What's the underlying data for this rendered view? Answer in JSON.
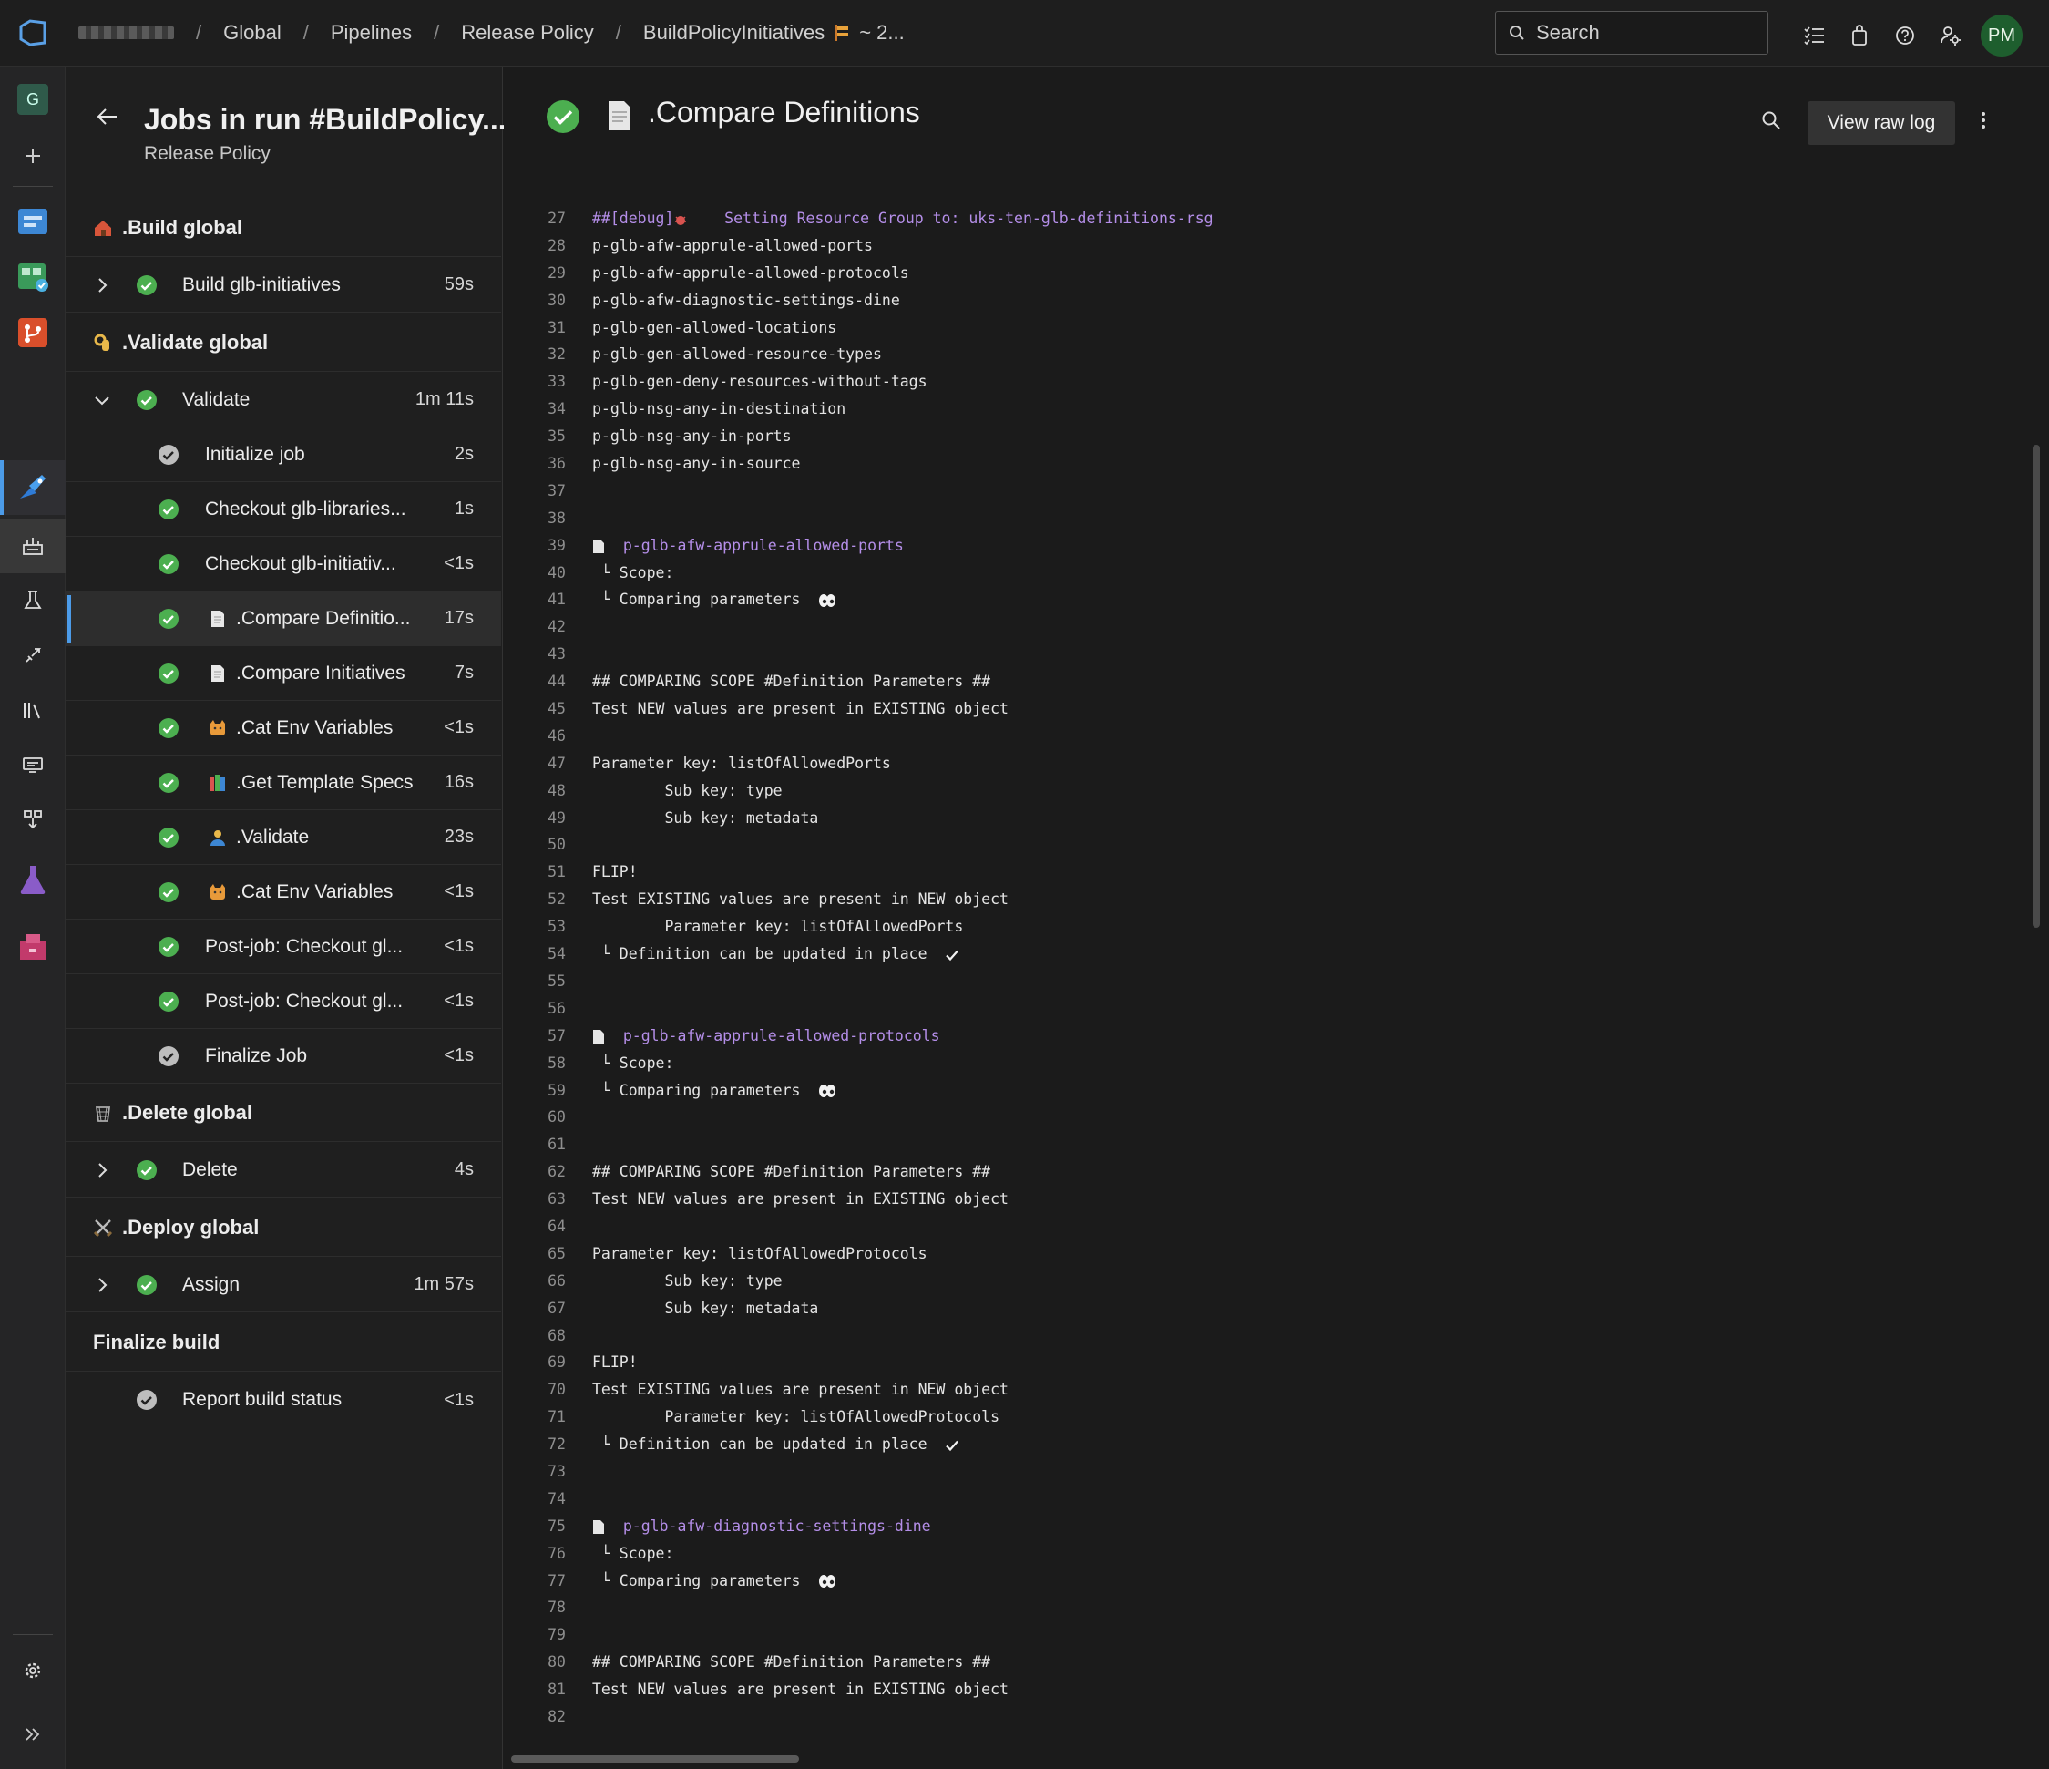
{
  "breadcrumb": {
    "items": [
      "Global",
      "Pipelines",
      "Release Policy",
      "BuildPolicyInitiatives"
    ],
    "run_suffix": "~ 2..."
  },
  "search": {
    "placeholder": "Search"
  },
  "user": {
    "initials": "PM"
  },
  "rail": {
    "org_initial": "G"
  },
  "jobs_panel": {
    "title": "Jobs in run #BuildPolicy...",
    "subtitle": "Release Policy",
    "stages": [
      {
        "name": ".Build global",
        "icon": "house-emoji-icon"
      },
      {
        "name": ".Validate global",
        "icon": "ok-hand-emoji-icon"
      },
      {
        "name": ".Delete global",
        "icon": "wastebasket-emoji-icon"
      },
      {
        "name": ".Deploy global",
        "icon": "crossed-swords-emoji-icon"
      },
      {
        "name": "Finalize build",
        "icon": ""
      }
    ],
    "jobs": [
      {
        "label": "Build glb-initiatives",
        "duration": "59s",
        "status": "succeeded",
        "expanded": false
      },
      {
        "label": "Validate",
        "duration": "1m 11s",
        "status": "succeeded",
        "expanded": true
      },
      {
        "label": "Delete",
        "duration": "4s",
        "status": "succeeded",
        "expanded": false
      },
      {
        "label": "Assign",
        "duration": "1m 57s",
        "status": "succeeded",
        "expanded": false
      },
      {
        "label": "Report build status",
        "duration": "<1s",
        "status": "completed",
        "expanded": false
      }
    ],
    "steps": [
      {
        "label": "Initialize job",
        "duration": "2s",
        "status": "completed",
        "icon": ""
      },
      {
        "label": "Checkout glb-libraries...",
        "duration": "1s",
        "status": "succeeded",
        "icon": ""
      },
      {
        "label": "Checkout glb-initiativ...",
        "duration": "<1s",
        "status": "succeeded",
        "icon": ""
      },
      {
        "label": ".Compare Definitio...",
        "duration": "17s",
        "status": "succeeded",
        "icon": "page-emoji-icon",
        "selected": true
      },
      {
        "label": ".Compare Initiatives",
        "duration": "7s",
        "status": "succeeded",
        "icon": "page-emoji-icon"
      },
      {
        "label": ".Cat Env Variables",
        "duration": "<1s",
        "status": "succeeded",
        "icon": "cat-emoji-icon"
      },
      {
        "label": ".Get Template Specs",
        "duration": "16s",
        "status": "succeeded",
        "icon": "books-emoji-icon"
      },
      {
        "label": ".Validate",
        "duration": "23s",
        "status": "succeeded",
        "icon": "person-emoji-icon"
      },
      {
        "label": ".Cat Env Variables",
        "duration": "<1s",
        "status": "succeeded",
        "icon": "cat-emoji-icon"
      },
      {
        "label": "Post-job: Checkout gl...",
        "duration": "<1s",
        "status": "succeeded",
        "icon": ""
      },
      {
        "label": "Post-job: Checkout gl...",
        "duration": "<1s",
        "status": "succeeded",
        "icon": ""
      },
      {
        "label": "Finalize Job",
        "duration": "<1s",
        "status": "completed",
        "icon": ""
      }
    ]
  },
  "log": {
    "title": ".Compare Definitions",
    "view_raw_label": "View raw log",
    "lines": [
      {
        "n": "27",
        "t": "##[debug]",
        "extra": "    Setting Resource Group to: uks-ten-glb-definitions-rsg",
        "kind": "debug"
      },
      {
        "n": "28",
        "t": "p-glb-afw-apprule-allowed-ports"
      },
      {
        "n": "29",
        "t": "p-glb-afw-apprule-allowed-protocols"
      },
      {
        "n": "30",
        "t": "p-glb-afw-diagnostic-settings-dine"
      },
      {
        "n": "31",
        "t": "p-glb-gen-allowed-locations"
      },
      {
        "n": "32",
        "t": "p-glb-gen-allowed-resource-types"
      },
      {
        "n": "33",
        "t": "p-glb-gen-deny-resources-without-tags"
      },
      {
        "n": "34",
        "t": "p-glb-nsg-any-in-destination"
      },
      {
        "n": "35",
        "t": "p-glb-nsg-any-in-ports"
      },
      {
        "n": "36",
        "t": "p-glb-nsg-any-in-source"
      },
      {
        "n": "37",
        "t": ""
      },
      {
        "n": "38",
        "t": ""
      },
      {
        "n": "39",
        "t": "  p-glb-afw-apprule-allowed-ports",
        "kind": "doc"
      },
      {
        "n": "40",
        "t": " └ Scope:"
      },
      {
        "n": "41",
        "t": " └ Comparing parameters  ",
        "kind": "eyes"
      },
      {
        "n": "42",
        "t": ""
      },
      {
        "n": "43",
        "t": ""
      },
      {
        "n": "44",
        "t": "## COMPARING SCOPE #Definition Parameters ##"
      },
      {
        "n": "45",
        "t": "Test NEW values are present in EXISTING object"
      },
      {
        "n": "46",
        "t": ""
      },
      {
        "n": "47",
        "t": "Parameter key: listOfAllowedPorts"
      },
      {
        "n": "48",
        "t": "        Sub key: type"
      },
      {
        "n": "49",
        "t": "        Sub key: metadata"
      },
      {
        "n": "50",
        "t": ""
      },
      {
        "n": "51",
        "t": "FLIP!"
      },
      {
        "n": "52",
        "t": "Test EXISTING values are present in NEW object"
      },
      {
        "n": "53",
        "t": "        Parameter key: listOfAllowedPorts"
      },
      {
        "n": "54",
        "t": " └ Definition can be updated in place  ",
        "kind": "check"
      },
      {
        "n": "55",
        "t": ""
      },
      {
        "n": "56",
        "t": ""
      },
      {
        "n": "57",
        "t": "  p-glb-afw-apprule-allowed-protocols",
        "kind": "doc"
      },
      {
        "n": "58",
        "t": " └ Scope:"
      },
      {
        "n": "59",
        "t": " └ Comparing parameters  ",
        "kind": "eyes"
      },
      {
        "n": "60",
        "t": ""
      },
      {
        "n": "61",
        "t": ""
      },
      {
        "n": "62",
        "t": "## COMPARING SCOPE #Definition Parameters ##"
      },
      {
        "n": "63",
        "t": "Test NEW values are present in EXISTING object"
      },
      {
        "n": "64",
        "t": ""
      },
      {
        "n": "65",
        "t": "Parameter key: listOfAllowedProtocols"
      },
      {
        "n": "66",
        "t": "        Sub key: type"
      },
      {
        "n": "67",
        "t": "        Sub key: metadata"
      },
      {
        "n": "68",
        "t": ""
      },
      {
        "n": "69",
        "t": "FLIP!"
      },
      {
        "n": "70",
        "t": "Test EXISTING values are present in NEW object"
      },
      {
        "n": "71",
        "t": "        Parameter key: listOfAllowedProtocols"
      },
      {
        "n": "72",
        "t": " └ Definition can be updated in place  ",
        "kind": "check"
      },
      {
        "n": "73",
        "t": ""
      },
      {
        "n": "74",
        "t": ""
      },
      {
        "n": "75",
        "t": "  p-glb-afw-diagnostic-settings-dine",
        "kind": "doc"
      },
      {
        "n": "76",
        "t": " └ Scope:"
      },
      {
        "n": "77",
        "t": " └ Comparing parameters  ",
        "kind": "eyes"
      },
      {
        "n": "78",
        "t": ""
      },
      {
        "n": "79",
        "t": ""
      },
      {
        "n": "80",
        "t": "## COMPARING SCOPE #Definition Parameters ##"
      },
      {
        "n": "81",
        "t": "Test NEW values are present in EXISTING object"
      },
      {
        "n": "82",
        "t": ""
      }
    ]
  },
  "colors": {
    "success": "#4caf50",
    "accent": "#4c9be8",
    "debug_purple": "#b48ee8"
  }
}
